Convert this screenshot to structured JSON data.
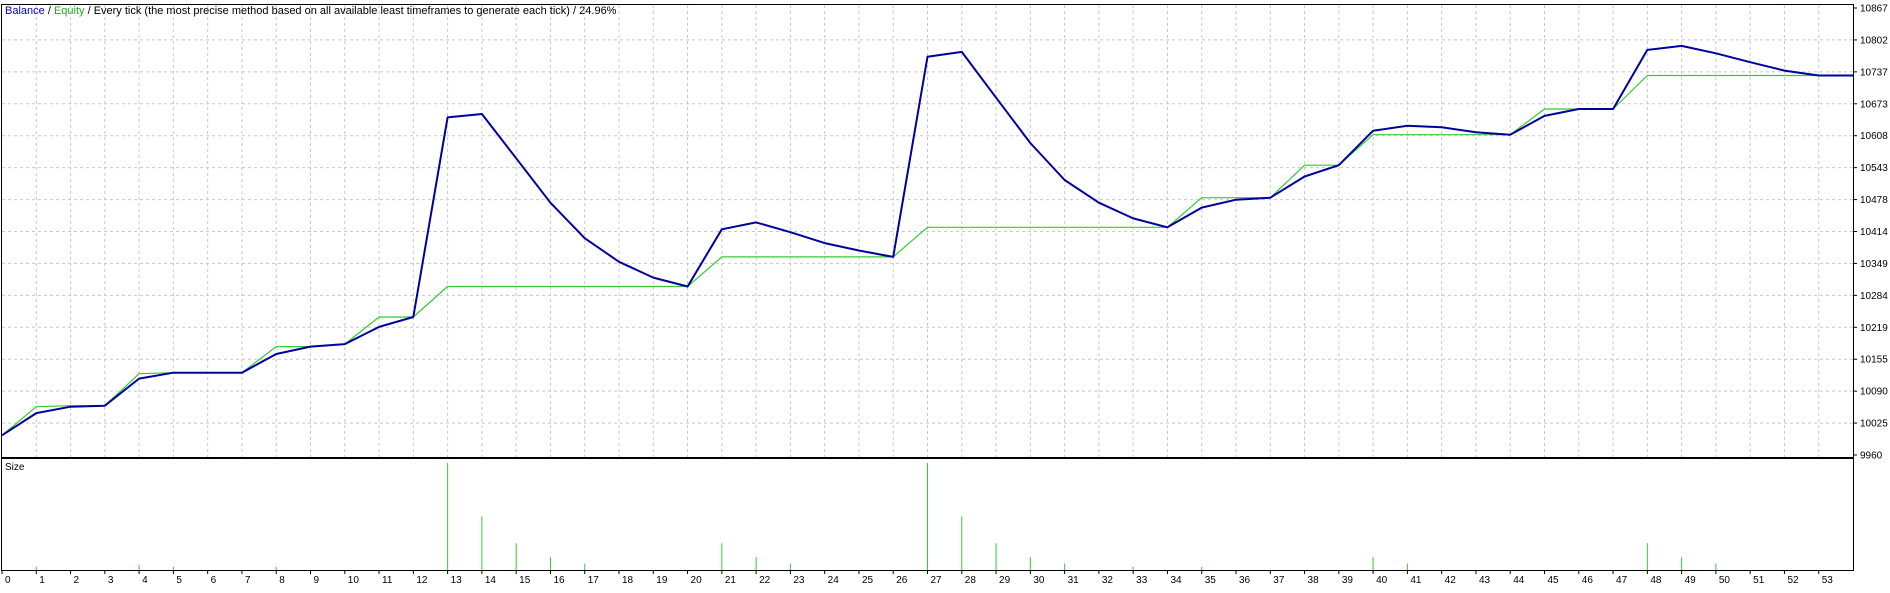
{
  "header": {
    "balance_label": "Balance",
    "sep1": " / ",
    "equity_label": "Equity",
    "sep2": " / ",
    "description": "Every tick (the most precise method based on all available least timeframes to generate each tick)",
    "sep3": " / ",
    "percent": "24.96%"
  },
  "colors": {
    "balance": "#0000a0",
    "equity": "#33cc33",
    "grid": "#c8c8c8",
    "axis": "#000000",
    "background": "#ffffff"
  },
  "chart_data": {
    "type": "line",
    "x": [
      0,
      1,
      2,
      3,
      4,
      5,
      6,
      7,
      8,
      9,
      10,
      11,
      12,
      13,
      14,
      15,
      16,
      17,
      18,
      19,
      20,
      21,
      22,
      23,
      24,
      25,
      26,
      27,
      28,
      29,
      30,
      31,
      32,
      33,
      34,
      35,
      36,
      37,
      38,
      39,
      40,
      41,
      42,
      43,
      44,
      45,
      46,
      47,
      48,
      49,
      50,
      51,
      52,
      53,
      54
    ],
    "x_tick_labels": [
      "0",
      "1",
      "2",
      "3",
      "4",
      "5",
      "6",
      "7",
      "8",
      "9",
      "10",
      "11",
      "12",
      "13",
      "14",
      "15",
      "16",
      "17",
      "18",
      "19",
      "20",
      "21",
      "22",
      "23",
      "24",
      "25",
      "26",
      "27",
      "28",
      "29",
      "30",
      "31",
      "32",
      "33",
      "34",
      "35",
      "36",
      "37",
      "38",
      "39",
      "40",
      "41",
      "42",
      "43",
      "44",
      "45",
      "46",
      "47",
      "48",
      "49",
      "50",
      "51",
      "52",
      "53"
    ],
    "y_tick_labels": [
      "10867",
      "10802",
      "10737",
      "10673",
      "10608",
      "10543",
      "10478",
      "10414",
      "10349",
      "10284",
      "10219",
      "10155",
      "10090",
      "10025",
      "9960"
    ],
    "ylim": [
      9960,
      10867
    ],
    "grid": true,
    "legend": "top-left",
    "series": [
      {
        "name": "Balance",
        "values": [
          10000,
          10045,
          10058,
          10060,
          10115,
          10127,
          10127,
          10127,
          10165,
          10180,
          10185,
          10220,
          10240,
          10645,
          10652,
          10562,
          10472,
          10400,
          10352,
          10320,
          10302,
          10418,
          10432,
          10412,
          10390,
          10375,
          10362,
          10768,
          10778,
          10685,
          10593,
          10518,
          10472,
          10440,
          10422,
          10462,
          10478,
          10482,
          10525,
          10548,
          10618,
          10628,
          10625,
          10615,
          10610,
          10648,
          10662,
          10662,
          10782,
          10790,
          10775,
          10757,
          10740,
          10730,
          10730
        ]
      },
      {
        "name": "Equity",
        "values": [
          10000,
          10058,
          10060,
          10060,
          10125,
          10127,
          10127,
          10127,
          10180,
          10180,
          10185,
          10240,
          10240,
          10302,
          10302,
          10302,
          10302,
          10302,
          10302,
          10302,
          10302,
          10362,
          10362,
          10362,
          10362,
          10362,
          10362,
          10422,
          10422,
          10422,
          10422,
          10422,
          10422,
          10422,
          10422,
          10482,
          10482,
          10482,
          10548,
          10548,
          10610,
          10610,
          10610,
          10610,
          10610,
          10662,
          10662,
          10662,
          10730,
          10730,
          10730,
          10730,
          10730,
          10730,
          10730
        ]
      }
    ],
    "size_panel": {
      "label": "Size",
      "values": [
        0,
        0.03,
        0,
        0,
        0.05,
        0.03,
        0,
        0,
        0.03,
        0,
        0,
        0,
        0,
        1.0,
        0.5,
        0.25,
        0.12,
        0.06,
        0,
        0,
        0,
        0.25,
        0.12,
        0.06,
        0,
        0,
        0,
        1.0,
        0.5,
        0.25,
        0.12,
        0.06,
        0,
        0.03,
        0,
        0.03,
        0,
        0,
        0,
        0,
        0.12,
        0.06,
        0,
        0,
        0,
        0,
        0,
        0,
        0.25,
        0.12,
        0.06,
        0,
        0,
        0,
        0
      ]
    }
  }
}
